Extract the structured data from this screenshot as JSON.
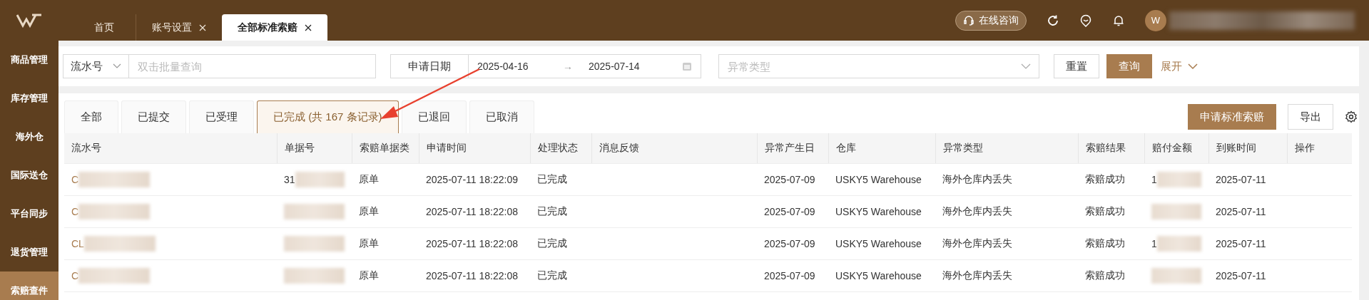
{
  "header": {
    "tabs": [
      {
        "label": "首页",
        "closable": false,
        "selected": false
      },
      {
        "label": "账号设置",
        "closable": true,
        "selected": false
      },
      {
        "label": "全部标准索赔",
        "closable": true,
        "selected": true
      }
    ],
    "consult_button": "在线咨询",
    "user": {
      "avatar_letter": "W",
      "name_blurred": true
    }
  },
  "sidebar": {
    "items": [
      {
        "label": "商品管理",
        "selected": false
      },
      {
        "label": "库存管理",
        "selected": false
      },
      {
        "label": "海外仓",
        "selected": false
      },
      {
        "label": "国际送仓",
        "selected": false
      },
      {
        "label": "平台同步",
        "selected": false
      },
      {
        "label": "退货管理",
        "selected": false
      },
      {
        "label": "索赔查件",
        "selected": true
      }
    ]
  },
  "filters": {
    "field_select": "流水号",
    "batch_search": {
      "placeholder": "双击批量查询"
    },
    "date_label": "申请日期",
    "date_from": "2025-04-16",
    "date_to": "2025-07-14",
    "date_separator": "→",
    "exception_type": {
      "placeholder": "异常类型"
    },
    "reset": "重置",
    "search": "查询",
    "expand": "展开"
  },
  "status_tabs": [
    {
      "label": "全部",
      "selected": false
    },
    {
      "label": "已提交",
      "selected": false
    },
    {
      "label": "已受理",
      "selected": false
    },
    {
      "label": "已完成 (共 167 条记录)",
      "selected": true
    },
    {
      "label": "已退回",
      "selected": false
    },
    {
      "label": "已取消",
      "selected": false
    }
  ],
  "actions": {
    "apply": "申请标准索赔",
    "export": "导出"
  },
  "table": {
    "columns": [
      "流水号",
      "单据号",
      "索赔单据类",
      "申请时间",
      "处理状态",
      "消息反馈",
      "异常产生日",
      "仓库",
      "异常类型",
      "索赔结果",
      "赔付金额",
      "到账时间",
      "操作"
    ],
    "rows": [
      {
        "serial": {
          "text": "C",
          "blurred": true
        },
        "doc_no": {
          "text": "31",
          "blurred": true
        },
        "doc_type": "原单",
        "applied": "2025-07-11 18:22:09",
        "status": "已完成",
        "occurred": "2025-07-09",
        "warehouse": "USKY5 Warehouse",
        "exception": "海外仓库内丢失",
        "result": "索赔成功",
        "amount": {
          "text": "1",
          "blurred": true
        },
        "credited": "2025-07-11"
      },
      {
        "serial": {
          "text": "C",
          "blurred": true
        },
        "doc_no": {
          "blurred": true
        },
        "doc_type": "原单",
        "applied": "2025-07-11 18:22:08",
        "status": "已完成",
        "occurred": "2025-07-09",
        "warehouse": "USKY5 Warehouse",
        "exception": "海外仓库内丢失",
        "result": "索赔成功",
        "amount": {
          "blurred": true
        },
        "credited": "2025-07-11"
      },
      {
        "serial": {
          "text": "CL",
          "blurred": true
        },
        "doc_no": {
          "blurred": true
        },
        "doc_type": "原单",
        "applied": "2025-07-11 18:22:08",
        "status": "已完成",
        "occurred": "2025-07-09",
        "warehouse": "USKY5 Warehouse",
        "exception": "海外仓库内丢失",
        "result": "索赔成功",
        "amount": {
          "text": "1",
          "blurred": true
        },
        "credited": "2025-07-11"
      },
      {
        "serial": {
          "text": "C",
          "blurred": true
        },
        "doc_no": {
          "blurred": true
        },
        "doc_type": "原单",
        "applied": "2025-07-11 18:22:08",
        "status": "已完成",
        "occurred": "2025-07-09",
        "warehouse": "USKY5 Warehouse",
        "exception": "海外仓库内丢失",
        "result": "索赔成功",
        "amount": {
          "blurred": true
        },
        "credited": "2025-07-11"
      }
    ]
  }
}
